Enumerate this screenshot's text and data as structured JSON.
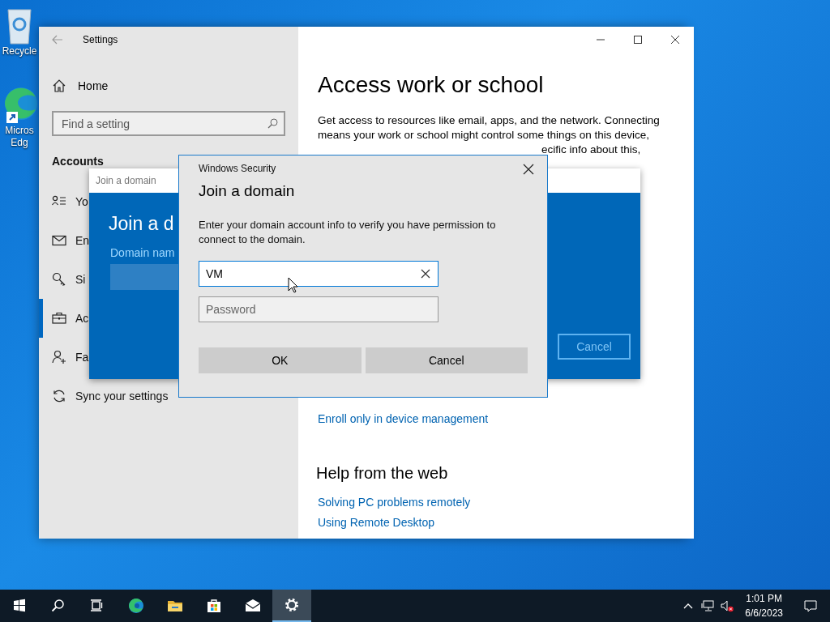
{
  "desktop": {
    "icons": [
      {
        "kind": "recycle",
        "lines": [
          "Recycle"
        ]
      },
      {
        "kind": "edge",
        "lines": [
          "Micros",
          "Edg"
        ]
      }
    ]
  },
  "settings_window": {
    "title": "Settings",
    "sidebar": {
      "home": "Home",
      "search": {
        "placeholder": "Find a setting"
      },
      "section": "Accounts",
      "items": [
        {
          "kind": "person-list",
          "label": "Yo",
          "selected": false
        },
        {
          "kind": "mail",
          "label": "En",
          "selected": false
        },
        {
          "kind": "key",
          "label": "Si",
          "selected": false
        },
        {
          "kind": "briefcase",
          "label": "Ac",
          "selected": true
        },
        {
          "kind": "person-add",
          "label": "Fa",
          "selected": false
        },
        {
          "kind": "sync",
          "label": "Sync your settings",
          "selected": false
        }
      ]
    },
    "content": {
      "title": "Access work or school",
      "paragraph": "Get access to resources like email, apps, and the network. Connecting means your work or school might control some things on this device,",
      "paragraph_tail": "ecific info about this,",
      "enroll_link": "Enroll only in device management",
      "help_heading": "Help from the web",
      "help_links": [
        "Solving PC problems remotely",
        "Using Remote Desktop"
      ]
    }
  },
  "join_domain_panel": {
    "title": "Join a domain",
    "heading": "Join a d",
    "field_label": "Domain nam",
    "cancel": "Cancel"
  },
  "security_dialog": {
    "caption": "Windows Security",
    "title": "Join a domain",
    "message": "Enter your domain account info to verify you have permission to connect to the domain.",
    "username": {
      "value": "VM"
    },
    "password": {
      "placeholder": "Password"
    },
    "buttons": [
      "OK",
      "Cancel"
    ]
  },
  "taskbar": {
    "apps": [
      {
        "kind": "start",
        "active": false
      },
      {
        "kind": "search",
        "active": false
      },
      {
        "kind": "taskview",
        "active": false
      },
      {
        "kind": "edge",
        "active": false
      },
      {
        "kind": "folder",
        "active": false
      },
      {
        "kind": "store",
        "active": false
      },
      {
        "kind": "mail",
        "active": false
      },
      {
        "kind": "settings",
        "active": true
      }
    ],
    "clock": {
      "time": "1:01 PM",
      "date": "6/6/2023"
    }
  }
}
